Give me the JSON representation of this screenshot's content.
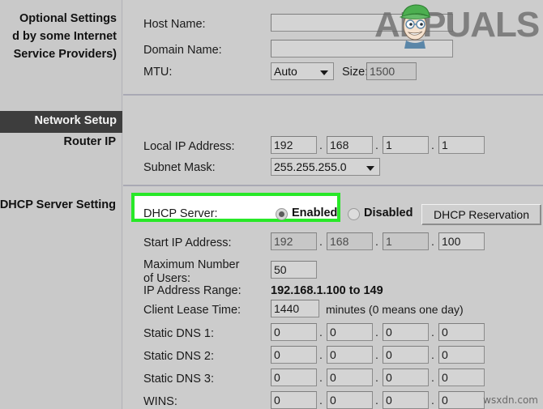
{
  "sidebar": {
    "optional_settings": {
      "line1": "Optional Settings",
      "line2": "d by some Internet",
      "line3": "Service Providers)"
    },
    "network_setup": "Network Setup",
    "router_ip": "Router IP",
    "dhcp_server_setting": "DHCP Server Setting"
  },
  "optional": {
    "host_name_label": "Host Name:",
    "host_name_value": "",
    "domain_name_label": "Domain Name:",
    "domain_name_value": "",
    "mtu_label": "MTU:",
    "mtu_value": "Auto",
    "size_label": "Size:",
    "size_value": "1500"
  },
  "router_ip": {
    "local_ip_label": "Local IP Address:",
    "local_ip": [
      "192",
      "168",
      "1",
      "1"
    ],
    "subnet_label": "Subnet Mask:",
    "subnet_value": "255.255.255.0",
    "separator": "."
  },
  "dhcp": {
    "server_label": "DHCP Server:",
    "enabled_label": "Enabled",
    "disabled_label": "Disabled",
    "selected": "Enabled",
    "reservation_button": "DHCP Reservation",
    "start_ip_label": "Start IP Address:",
    "start_ip": [
      "192",
      "168",
      "1",
      "100"
    ],
    "max_users_label": "Maximum Number of Users:",
    "max_users_value": "50",
    "ip_range_label": "IP Address Range:",
    "ip_range_value": "192.168.1.100   to  149",
    "lease_label": "Client Lease Time:",
    "lease_value": "1440",
    "lease_suffix": "minutes (0 means one day)",
    "static_dns_1_label": "Static DNS 1:",
    "static_dns_1": [
      "0",
      "0",
      "0",
      "0"
    ],
    "static_dns_2_label": "Static DNS 2:",
    "static_dns_2": [
      "0",
      "0",
      "0",
      "0"
    ],
    "static_dns_3_label": "Static DNS 3:",
    "static_dns_3": [
      "0",
      "0",
      "0",
      "0"
    ],
    "wins_label": "WINS:",
    "wins": [
      "0",
      "0",
      "0",
      "0"
    ],
    "separator": "."
  },
  "watermarks": {
    "brand": "APPUALS",
    "site": "wsxdn.com"
  },
  "colors": {
    "highlight": "#28e828",
    "panel_bg": "#cccccc",
    "sidebar_bar": "#3d3d3d"
  }
}
